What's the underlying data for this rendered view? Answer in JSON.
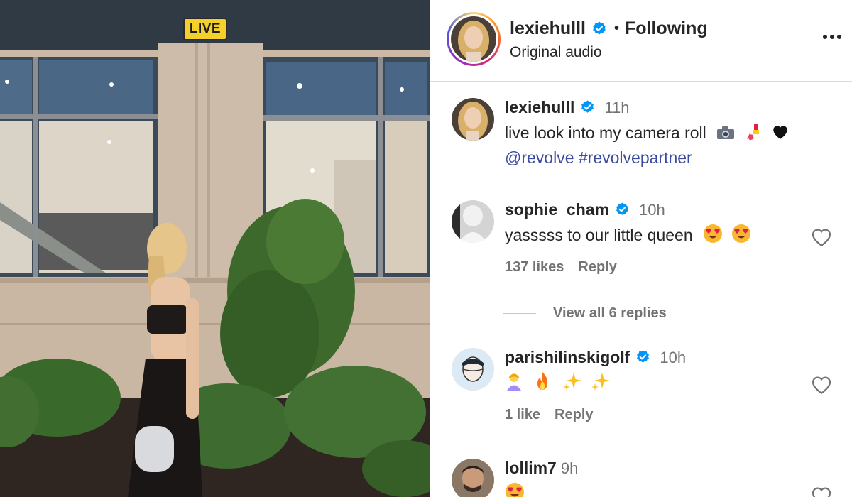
{
  "video": {
    "live_label": "LIVE"
  },
  "header": {
    "username": "lexiehulll",
    "separator": "•",
    "follow_status": "Following",
    "audio": "Original audio",
    "more_icon": "more-horizontal-icon"
  },
  "comments": [
    {
      "username": "lexiehulll",
      "time": "11h",
      "text": "live look into my camera roll",
      "text_emojis": [
        "camera-icon",
        "lipstick-icon",
        "black-heart-icon"
      ],
      "mentions": "@revolve #revolvepartner"
    },
    {
      "username": "sophie_cham",
      "time": "10h",
      "text": "yasssss to our little queen",
      "text_emojis": [
        "heart-eyes-emoji",
        "heart-eyes-emoji"
      ],
      "likes": "137 likes",
      "reply": "Reply"
    },
    {
      "view_replies": "View all 6 replies"
    },
    {
      "username": "parishilinskigolf",
      "time": "10h",
      "text_emojis": [
        "woman-bowing-emoji",
        "fire-emoji",
        "sparkles-emoji",
        "sparkles-emoji"
      ],
      "likes": "1 like",
      "reply": "Reply"
    },
    {
      "username": "lollim7",
      "time": "9h",
      "text_emojis": [
        "heart-eyes-emoji"
      ]
    }
  ],
  "colors": {
    "verified": "#0095f6",
    "link": "#3b4b9e",
    "live_badge": "#f4d12a",
    "muted_text": "#737373"
  }
}
